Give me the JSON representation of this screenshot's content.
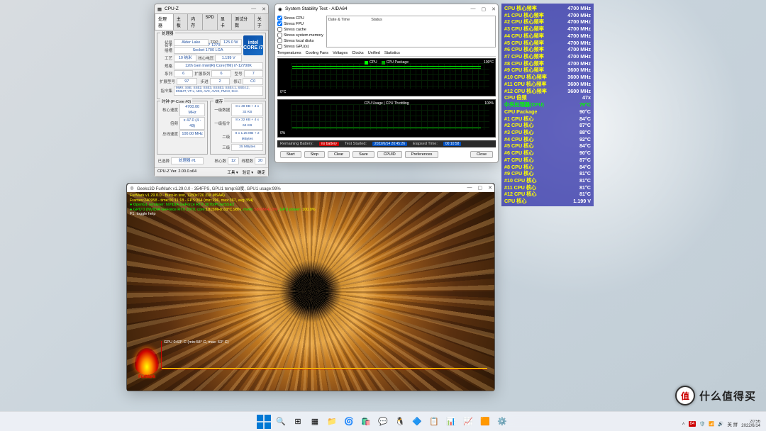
{
  "cpuz": {
    "title": "CPU-Z",
    "tabs": [
      "处理器",
      "主板",
      "内存",
      "SPD",
      "显卡",
      "测试分数",
      "关于"
    ],
    "section_cpu": "处理器",
    "name_lbl": "名字",
    "name": "Intel Core i7 12700K",
    "code_lbl": "代号",
    "code": "Alder Lake",
    "tdp_lbl": "TDP",
    "tdp": "125.0 W",
    "socket_lbl": "插槽",
    "socket": "Socket 1700 LGA",
    "tech_lbl": "工艺",
    "tech": "10 纳米",
    "volt_lbl": "核心电压",
    "volt": "1.199 V",
    "spec_lbl": "规格",
    "spec": "12th Gen Intel(R) Core(TM) i7-12700K",
    "family_lbl": "系列",
    "family": "6",
    "extfam_lbl": "扩展系列",
    "extfam": "6",
    "model_lbl": "型号",
    "model": "7",
    "extmodel_lbl": "扩展型号",
    "extmodel": "97",
    "step_lbl": "步进",
    "step": "2",
    "rev_lbl": "修订",
    "rev": "C0",
    "instr_lbl": "指令集",
    "instr": "MMX, SSE, SSE2, SSE3, SSSE3, SSE4.1, SSE4.2, EM64T, VT-x, AES, AVX, AVX2, FMA3, SHA",
    "section_clock": "时钟 (P-Core #0)",
    "clk_lbl": "核心速度",
    "clk": "4700.00 MHz",
    "mult_lbl": "倍频",
    "mult": "x 47.0 (4 - 49)",
    "bus_lbl": "总线速度",
    "bus": "100.00 MHz",
    "section_cache": "缓存",
    "l1d_lbl": "一级数据",
    "l1d": "8 x 48 KB + 4 x 32 KB",
    "l1i_lbl": "一级指令",
    "l1i": "8 x 32 KB + 4 x 64 KB",
    "l2_lbl": "二级",
    "l2": "8 x 1.25 MB + 2 MBytes",
    "l3_lbl": "三级",
    "l3": "25 MBytes",
    "sel_lbl": "已选择",
    "sel": "处理器 #1",
    "cores_lbl": "核心数",
    "cores_val": "12",
    "threads_lbl": "线程数",
    "threads_val": "20",
    "footer_ver": "CPU-Z  Ver. 2.00.0.x64",
    "footer_tools": "工具 ▾",
    "footer_valid": "验证 ▾",
    "footer_close": "确定",
    "logo": "intel\nCORE\ni7"
  },
  "aida": {
    "title": "System Stability Test - AIDA64",
    "checks": [
      "Stress CPU",
      "Stress FPU",
      "Stress cache",
      "Stress system memory",
      "Stress local disks",
      "Stress GPU(s)"
    ],
    "checked": [
      true,
      true,
      false,
      false,
      false,
      false
    ],
    "log_cols": [
      "Date & Time",
      "Status"
    ],
    "subtabs": [
      "Temperatures",
      "Cooling Fans",
      "Voltages",
      "Clocks",
      "Unified",
      "Statistics"
    ],
    "chart1_legend": [
      "CPU",
      "CPU Package"
    ],
    "chart1_scale_hi": "100°C",
    "chart1_scale_lo": "0°C",
    "chart2_title": "CPU Usage  |  CPU Throttling",
    "chart2_hi": "100%",
    "chart2_lo": "0%",
    "status": {
      "bat_lbl": "Remaining Battery:",
      "bat": "no battery",
      "started_lbl": "Test Started:",
      "started": "2022/6/14 20:45:26",
      "elapsed_lbl": "Elapsed Time:",
      "elapsed": "00:10:58"
    },
    "buttons": [
      "Start",
      "Stop",
      "Clear",
      "Save",
      "CPUID",
      "Preferences",
      "Close"
    ]
  },
  "osd": {
    "rows": [
      {
        "l": "CPU 核心频率",
        "v": "4700 MHz"
      },
      {
        "l": "#1 CPU 核心频率",
        "v": "4700 MHz"
      },
      {
        "l": "#2 CPU 核心频率",
        "v": "4700 MHz"
      },
      {
        "l": "#3 CPU 核心频率",
        "v": "4700 MHz"
      },
      {
        "l": "#4 CPU 核心频率",
        "v": "4700 MHz"
      },
      {
        "l": "#5 CPU 核心频率",
        "v": "4700 MHz"
      },
      {
        "l": "#6 CPU 核心频率",
        "v": "4700 MHz"
      },
      {
        "l": "#7 CPU 核心频率",
        "v": "4700 MHz"
      },
      {
        "l": "#8 CPU 核心频率",
        "v": "4700 MHz"
      },
      {
        "l": "#9 CPU 核心频率",
        "v": "3600 MHz"
      },
      {
        "l": "#10 CPU 核心频率",
        "v": "3600 MHz"
      },
      {
        "l": "#11 CPU 核心频率",
        "v": "3600 MHz"
      },
      {
        "l": "#12 CPU 核心频率",
        "v": "3600 MHz"
      },
      {
        "l": "CPU 倍频",
        "v": "47x"
      },
      {
        "l": "中央处理器(CPU)",
        "v": "79°C",
        "cls": "green"
      },
      {
        "l": "CPU Package",
        "v": "90°C"
      },
      {
        "l": "#1 CPU 核心",
        "v": "84°C"
      },
      {
        "l": "#2 CPU 核心",
        "v": "87°C"
      },
      {
        "l": "#3 CPU 核心",
        "v": "88°C"
      },
      {
        "l": "#4 CPU 核心",
        "v": "92°C"
      },
      {
        "l": "#5 CPU 核心",
        "v": "84°C"
      },
      {
        "l": "#6 CPU 核心",
        "v": "90°C"
      },
      {
        "l": "#7 CPU 核心",
        "v": "87°C"
      },
      {
        "l": "#8 CPU 核心",
        "v": "84°C"
      },
      {
        "l": "#9 CPU 核心",
        "v": "81°C"
      },
      {
        "l": "#10 CPU 核心",
        "v": "81°C"
      },
      {
        "l": "#11 CPU 核心",
        "v": "81°C"
      },
      {
        "l": "#12 CPU 核心",
        "v": "81°C"
      },
      {
        "l": "CPU 核心",
        "v": "1.199 V"
      }
    ]
  },
  "furmark": {
    "title": "Geeks3D FurMark v1.29.0.0 - 354FPS, GPU1 temp:63度, GPU1 usage:99%",
    "l1": "FurMark v1.29.0.0 - Burn-in test, 1280x720 (0X MSAA)",
    "l2": "Frames:240958 - time:00:11:18 - FPS:354 (min:296, max:367, avg:354)",
    "l3a": "● OpenGL renderer: ",
    "l3b": "NVIDIA GeForce RTX 3070/PCIe/SSE2",
    "l4a": "● GPU 0 (NVIDIA GeForce RTX 3070,  core:",
    "l4b": "1815MHz,63°C,98%",
    "l4c": ", mem: ",
    "l4d": "5800MHz,0%",
    "l4e": ", GPU power: ",
    "l4f": "100.0%",
    "l5": "F1: toggle help",
    "graph_lbl": "GPU 0:63° C (min:58° C,  max: 63° C)",
    "logo": "FurMark"
  },
  "taskbar": {
    "icons": [
      "start",
      "search",
      "tasks",
      "widgets",
      "explorer",
      "edge",
      "store",
      "wechat",
      "qq",
      "video1",
      "video2",
      "app1",
      "app2",
      "app3",
      "app4"
    ],
    "tray": {
      "t64": "64",
      "ime": "英 拼",
      "time": "20:56",
      "date": "2022/6/14"
    }
  },
  "watermark": {
    "badge": "值",
    "text": "什么值得买"
  }
}
